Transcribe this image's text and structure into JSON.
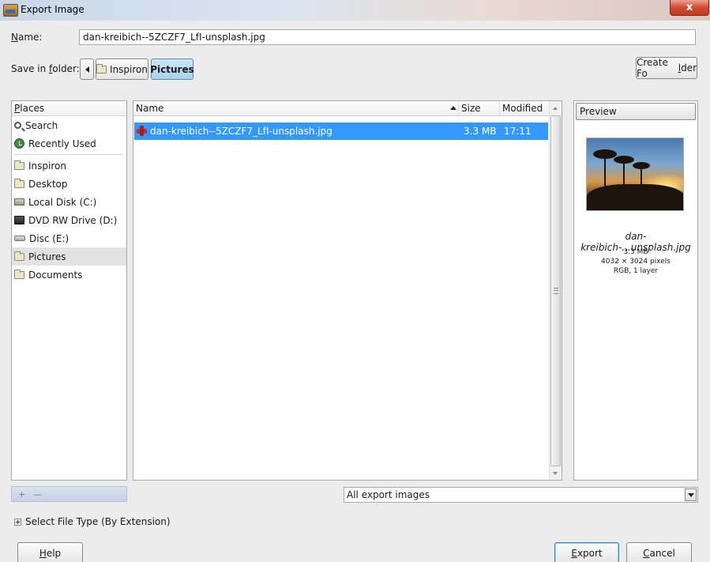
{
  "window": {
    "title": "Export Image",
    "close_label": "x"
  },
  "form": {
    "name_label_prefix": "N",
    "name_label_rest": "ame:",
    "name_value": "dan-kreibich--5ZCZF7_LfI-unsplash.jpg",
    "save_label_prefix": "Save in ",
    "save_label_ul": "f",
    "save_label_rest": "older:",
    "path": [
      "Inspiron",
      "Pictures"
    ],
    "create_folder_prefix": "Create Fo",
    "create_folder_ul": "l",
    "create_folder_rest": "der"
  },
  "places": {
    "header_ul": "P",
    "header_rest": "laces",
    "items": [
      {
        "label": "Search",
        "icon": "search-icon"
      },
      {
        "label": "Recently Used",
        "icon": "recent-icon"
      },
      {
        "label": "Inspiron",
        "icon": "folder-icon"
      },
      {
        "label": "Desktop",
        "icon": "folder-icon"
      },
      {
        "label": "Local Disk (C:)",
        "icon": "hard-disk-icon"
      },
      {
        "label": "DVD RW Drive (D:)",
        "icon": "dvd-drive-icon"
      },
      {
        "label": "Disc (E:)",
        "icon": "disc-drive-icon"
      },
      {
        "label": "Pictures",
        "icon": "folder-icon",
        "selected": true
      },
      {
        "label": "Documents",
        "icon": "folder-icon"
      }
    ],
    "add_button": "+",
    "remove_button": "—"
  },
  "files": {
    "columns": {
      "name": "Name",
      "size": "Size",
      "modified": "Modified"
    },
    "rows": [
      {
        "name": "dan-kreibich--5ZCZF7_LfI-unsplash.jpg",
        "size": "3.3 MB",
        "modified": "17:11",
        "selected": true
      }
    ]
  },
  "preview": {
    "button_label": "Preview",
    "name": "dan-kreibich-...unsplash.jpg",
    "size": "3.3 MB",
    "dimensions": "4032 × 3024 pixels",
    "mode": "RGB, 1 layer"
  },
  "filter": {
    "selected": "All export images"
  },
  "file_type": {
    "label": "Select File Type (By Extension)"
  },
  "buttons": {
    "help_ul": "H",
    "help_rest": "elp",
    "export_ul": "E",
    "export_rest": "xport",
    "cancel_ul": "C",
    "cancel_rest": "ancel"
  },
  "colors": {
    "selection": "#3399ff",
    "close_button": "#d24b2f"
  }
}
